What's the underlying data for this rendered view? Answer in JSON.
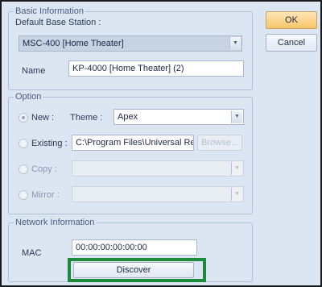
{
  "basic_info": {
    "legend": "Basic Information",
    "default_base_station_label": "Default Base Station :",
    "default_base_station_value": "MSC-400 [Home Theater]",
    "name_label": "Name",
    "name_value": "KP-4000 [Home Theater] (2)"
  },
  "option": {
    "legend": "Option",
    "new_label": "New :",
    "theme_label": "Theme :",
    "theme_value": "Apex",
    "existing_label": "Existing :",
    "existing_path": "C:\\Program Files\\Universal Re",
    "browse_label": "Browse...",
    "copy_label": "Copy :",
    "mirror_label": "Mirror :"
  },
  "network": {
    "legend": "Network Information",
    "mac_label": "MAC",
    "mac_value": "00:00:00:00:00:00",
    "discover_label": "Discover"
  },
  "actions": {
    "ok_label": "OK",
    "cancel_label": "Cancel"
  },
  "colors": {
    "highlight": "#1e8a3c",
    "ok_button": "#f8c66a"
  }
}
